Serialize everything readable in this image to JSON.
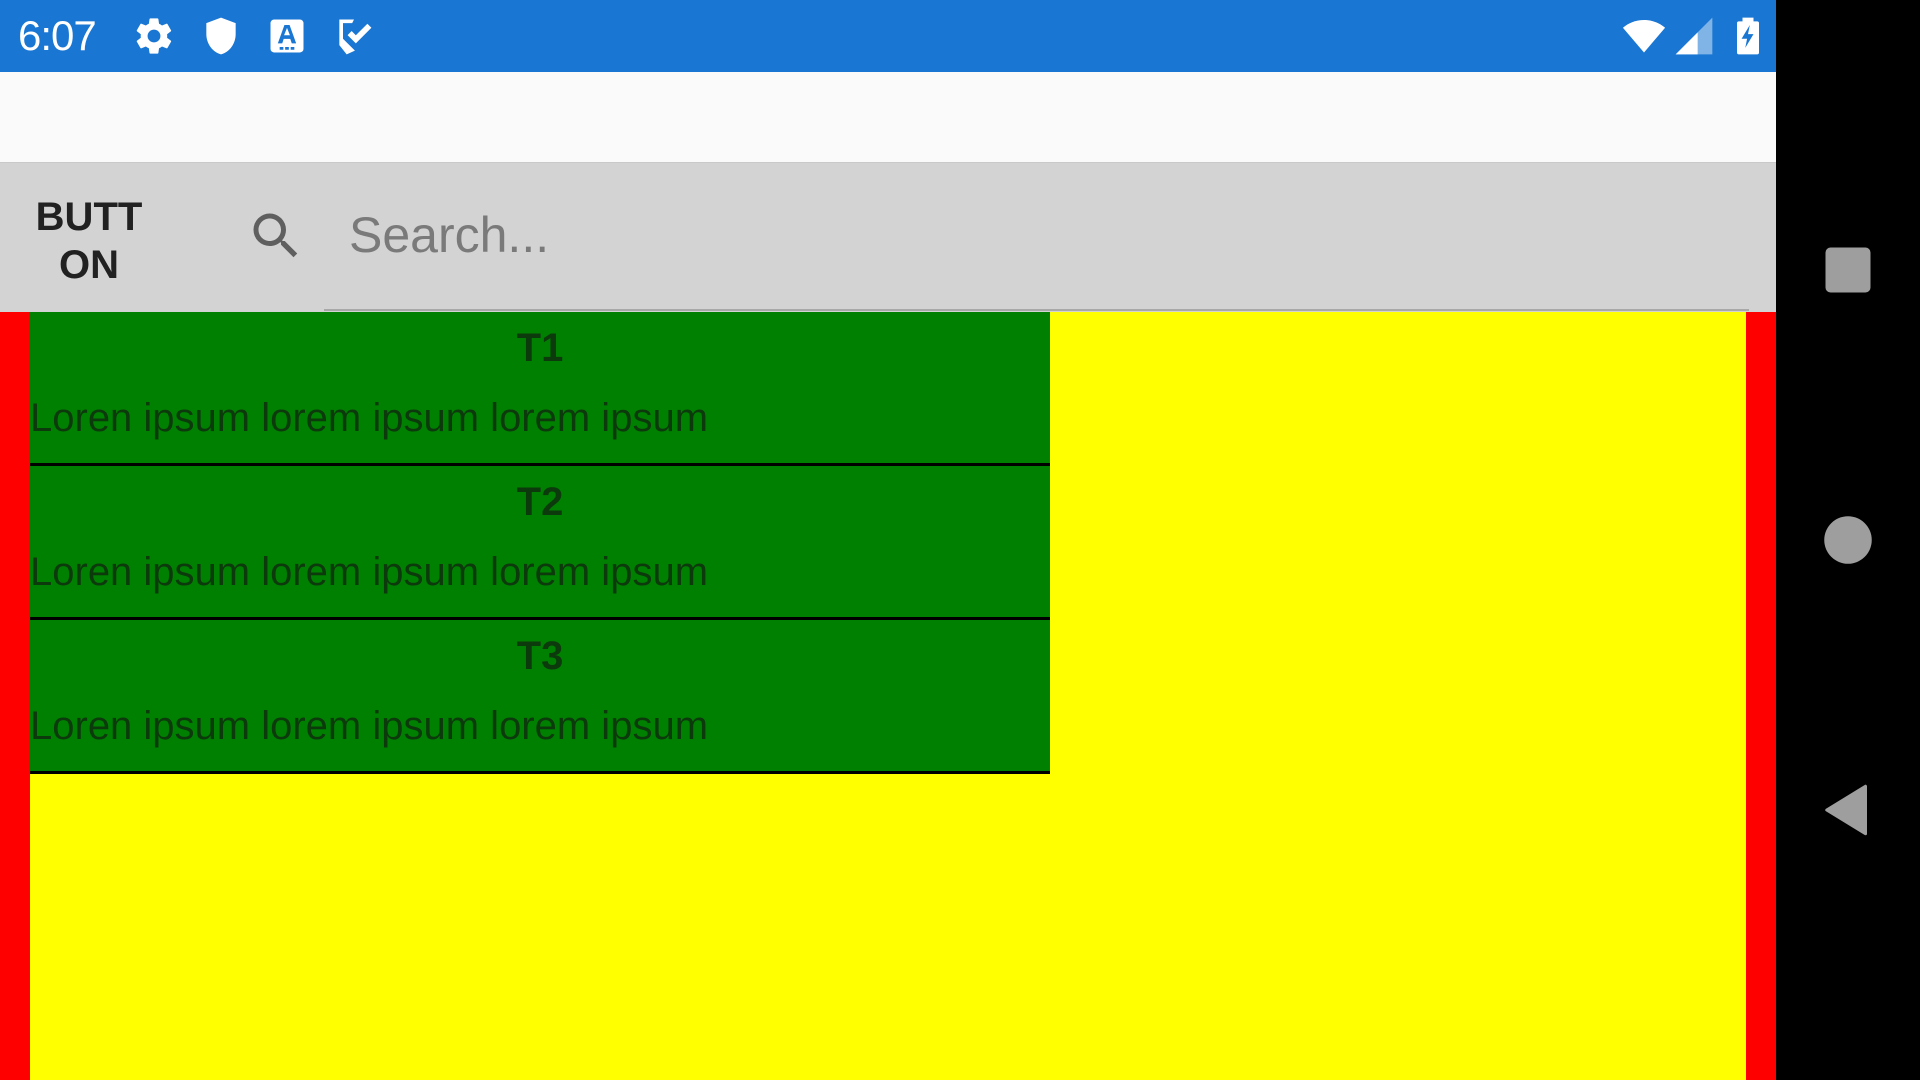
{
  "status_bar": {
    "time": "6:07",
    "background": "#1976d2",
    "left_icons": [
      "settings-icon",
      "shield-icon",
      "font-a-icon",
      "task-check-icon"
    ],
    "right_icons": [
      "wifi-icon",
      "cell-signal-icon",
      "battery-charging-icon"
    ]
  },
  "toolbar": {
    "button_label": "BUTTON",
    "search": {
      "placeholder": "Search...",
      "value": ""
    }
  },
  "list": {
    "items": [
      {
        "title": "T1",
        "body": "Loren ipsum lorem ipsum lorem ipsum"
      },
      {
        "title": "T2",
        "body": "Loren ipsum lorem ipsum lorem ipsum"
      },
      {
        "title": "T3",
        "body": "Loren ipsum lorem ipsum lorem ipsum"
      }
    ]
  },
  "colors": {
    "content_border": "#ff0000",
    "content_background": "#ffff00",
    "list_item_background": "#008000",
    "toolbar_background": "#d3d3d3"
  },
  "nav_bar": {
    "buttons": [
      "recents-icon",
      "home-icon",
      "back-icon"
    ]
  }
}
